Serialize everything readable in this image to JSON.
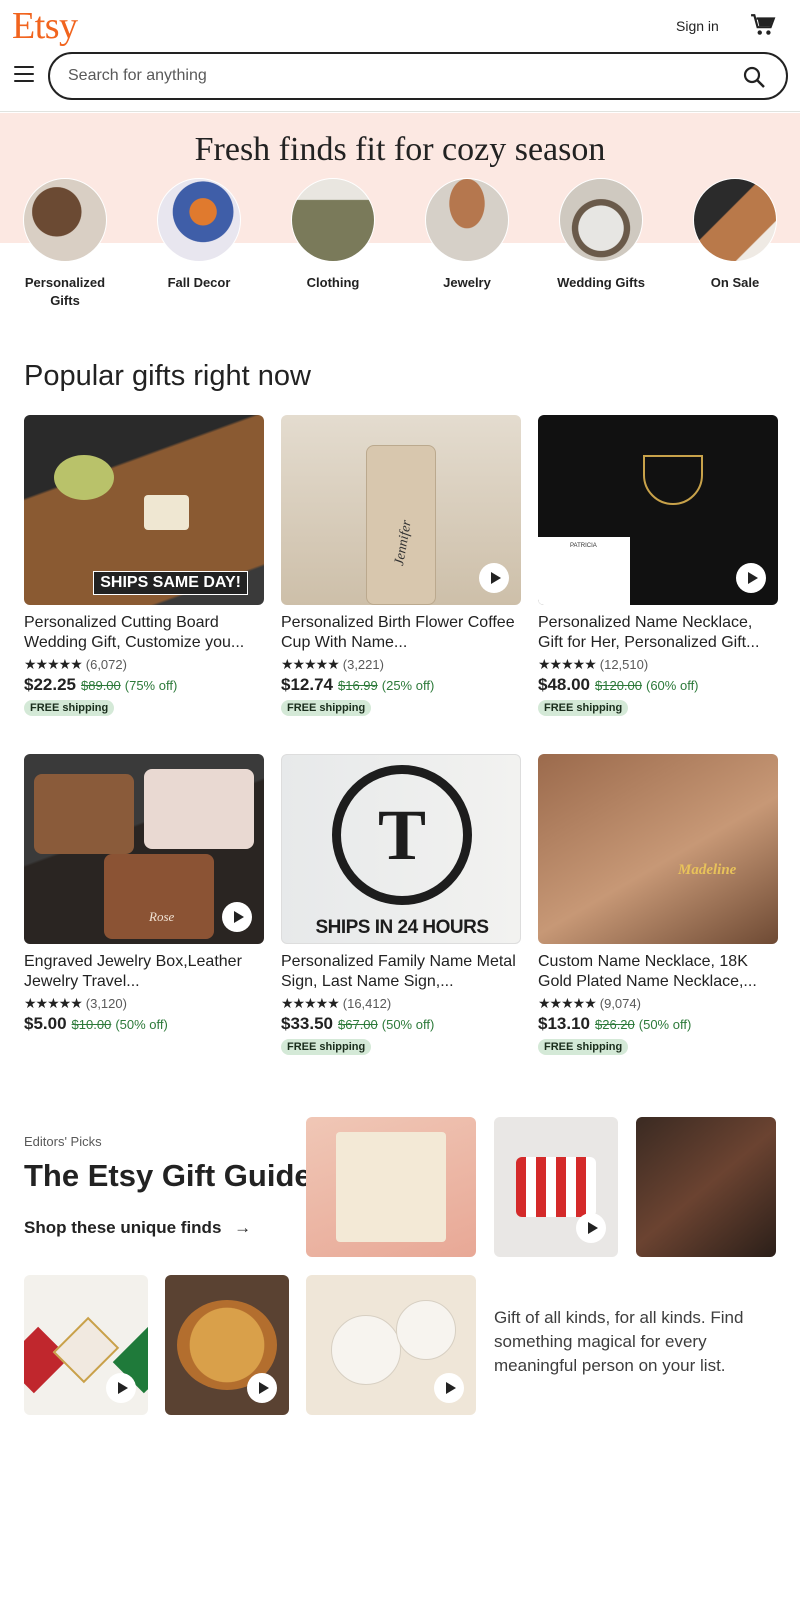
{
  "header": {
    "logo": "Etsy",
    "sign_in": "Sign in",
    "search_placeholder": "Search for anything"
  },
  "banner": {
    "title": "Fresh finds fit for cozy season",
    "categories": [
      {
        "label": "Personalized Gifts"
      },
      {
        "label": "Fall Decor"
      },
      {
        "label": "Clothing"
      },
      {
        "label": "Jewelry"
      },
      {
        "label": "Wedding Gifts"
      },
      {
        "label": "On Sale"
      }
    ]
  },
  "popular": {
    "title": "Popular gifts right now",
    "items": [
      {
        "title": "Personalized Cutting Board Wedding Gift, Customize you...",
        "reviews": "(6,072)",
        "price": "$22.25",
        "original": "$89.00",
        "discount": "(75% off)",
        "badge": "FREE shipping",
        "image_text": "SHIPS SAME DAY!"
      },
      {
        "title": "Personalized Birth Flower Coffee Cup With Name...",
        "reviews": "(3,221)",
        "price": "$12.74",
        "original": "$16.99",
        "discount": "(25% off)",
        "badge": "FREE shipping",
        "image_text": "Jennifer"
      },
      {
        "title": "Personalized Name Necklace, Gift for Her, Personalized Gift...",
        "reviews": "(12,510)",
        "price": "$48.00",
        "original": "$120.00",
        "discount": "(60% off)",
        "badge": "FREE shipping",
        "image_text": "PATRICIA"
      },
      {
        "title": "Engraved Jewelry Box,Leather Jewelry Travel...",
        "reviews": "(3,120)",
        "price": "$5.00",
        "original": "$10.00",
        "discount": "(50% off)",
        "badge": "",
        "image_text": "Rose"
      },
      {
        "title": "Personalized Family Name Metal Sign, Last Name Sign,...",
        "reviews": "(16,412)",
        "price": "$33.50",
        "original": "$67.00",
        "discount": "(50% off)",
        "badge": "FREE shipping",
        "image_text": "SHIPS IN 24 HOURS"
      },
      {
        "title": "Custom Name Necklace, 18K Gold Plated Name Necklace,...",
        "reviews": "(9,074)",
        "price": "$13.10",
        "original": "$26.20",
        "discount": "(50% off)",
        "badge": "FREE shipping",
        "image_text": "Madeline"
      }
    ]
  },
  "gift_guide": {
    "eyebrow": "Editors' Picks",
    "title": "The Etsy Gift Guide",
    "link": "Shop these unique finds",
    "description": "Gift of all kinds, for all kinds. Find something magical for every meaningful person on your list."
  },
  "colors": {
    "brand": "#f1641e",
    "banner_bg": "#fce8e2",
    "sale_green": "#2d7a3a",
    "badge_bg": "#d4e9d7"
  },
  "stars": "★★★★★"
}
